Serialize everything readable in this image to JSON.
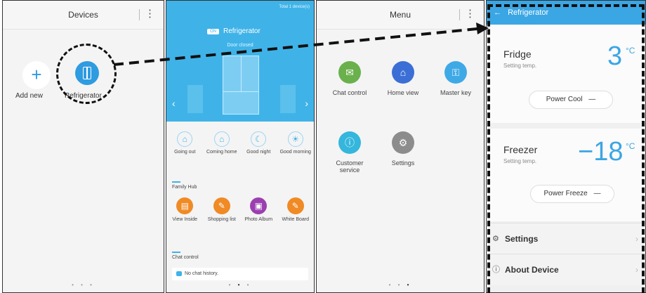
{
  "screen1": {
    "title": "Devices",
    "more_icon": "⋮",
    "add_label": "Add new",
    "device_label": "Refrigerator",
    "pagination": "• • •"
  },
  "screen2": {
    "total": "Total 1 device(s)",
    "tag": "ON",
    "title": "Refrigerator",
    "door_status": "Door closed",
    "actions": [
      {
        "label": "Going out",
        "icon": "going-out-icon",
        "glyph": "⌂"
      },
      {
        "label": "Coming home",
        "icon": "coming-home-icon",
        "glyph": "⌂"
      },
      {
        "label": "Good night",
        "icon": "moon-icon",
        "glyph": "☾"
      },
      {
        "label": "Good morning",
        "icon": "sun-icon",
        "glyph": "☀"
      }
    ],
    "family_hub_label": "Family Hub",
    "hub": [
      {
        "label": "View Inside",
        "color": "#f08a24",
        "glyph": "▤"
      },
      {
        "label": "Shopping list",
        "color": "#f08a24",
        "glyph": "✎"
      },
      {
        "label": "Photo Album",
        "color": "#9b3fb0",
        "glyph": "▣"
      },
      {
        "label": "White Board",
        "color": "#f08a24",
        "glyph": "✎"
      }
    ],
    "chat_label": "Chat control",
    "chat_empty": "No chat history."
  },
  "screen3": {
    "title": "Menu",
    "items": [
      {
        "label": "Chat control",
        "color": "#6ab04c",
        "glyph": "✉"
      },
      {
        "label": "Home view",
        "color": "#3b6fd6",
        "glyph": "⌂"
      },
      {
        "label": "Master key",
        "color": "#3fa9e6",
        "glyph": "⚿"
      },
      {
        "label": "Customer service",
        "color": "#35b6dd",
        "glyph": "ⓘ"
      },
      {
        "label": "Settings",
        "color": "#8c8c8c",
        "glyph": "⚙"
      }
    ]
  },
  "screen4": {
    "back": "←",
    "title": "Refrigerator",
    "fridge_name": "Fridge",
    "fridge_sub": "Setting temp.",
    "fridge_temp": "3",
    "unit": "°C",
    "power_cool": "Power Cool",
    "freezer_name": "Freezer",
    "freezer_sub": "Setting temp.",
    "freezer_temp": "−18",
    "power_freeze": "Power Freeze",
    "pill_minus": "—",
    "settings_label": "Settings",
    "about_label": "About Device",
    "chevron": "›"
  },
  "colors": {
    "accent": "#3ba6e4",
    "hero": "#3fb3e8"
  }
}
